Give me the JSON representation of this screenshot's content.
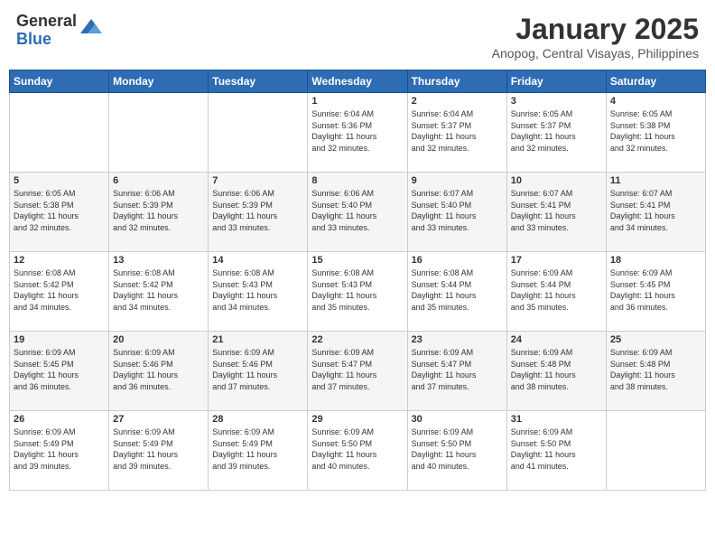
{
  "header": {
    "logo_general": "General",
    "logo_blue": "Blue",
    "month_title": "January 2025",
    "location": "Anopog, Central Visayas, Philippines"
  },
  "weekdays": [
    "Sunday",
    "Monday",
    "Tuesday",
    "Wednesday",
    "Thursday",
    "Friday",
    "Saturday"
  ],
  "weeks": [
    [
      {
        "day": "",
        "info": ""
      },
      {
        "day": "",
        "info": ""
      },
      {
        "day": "",
        "info": ""
      },
      {
        "day": "1",
        "info": "Sunrise: 6:04 AM\nSunset: 5:36 PM\nDaylight: 11 hours\nand 32 minutes."
      },
      {
        "day": "2",
        "info": "Sunrise: 6:04 AM\nSunset: 5:37 PM\nDaylight: 11 hours\nand 32 minutes."
      },
      {
        "day": "3",
        "info": "Sunrise: 6:05 AM\nSunset: 5:37 PM\nDaylight: 11 hours\nand 32 minutes."
      },
      {
        "day": "4",
        "info": "Sunrise: 6:05 AM\nSunset: 5:38 PM\nDaylight: 11 hours\nand 32 minutes."
      }
    ],
    [
      {
        "day": "5",
        "info": "Sunrise: 6:05 AM\nSunset: 5:38 PM\nDaylight: 11 hours\nand 32 minutes."
      },
      {
        "day": "6",
        "info": "Sunrise: 6:06 AM\nSunset: 5:39 PM\nDaylight: 11 hours\nand 32 minutes."
      },
      {
        "day": "7",
        "info": "Sunrise: 6:06 AM\nSunset: 5:39 PM\nDaylight: 11 hours\nand 33 minutes."
      },
      {
        "day": "8",
        "info": "Sunrise: 6:06 AM\nSunset: 5:40 PM\nDaylight: 11 hours\nand 33 minutes."
      },
      {
        "day": "9",
        "info": "Sunrise: 6:07 AM\nSunset: 5:40 PM\nDaylight: 11 hours\nand 33 minutes."
      },
      {
        "day": "10",
        "info": "Sunrise: 6:07 AM\nSunset: 5:41 PM\nDaylight: 11 hours\nand 33 minutes."
      },
      {
        "day": "11",
        "info": "Sunrise: 6:07 AM\nSunset: 5:41 PM\nDaylight: 11 hours\nand 34 minutes."
      }
    ],
    [
      {
        "day": "12",
        "info": "Sunrise: 6:08 AM\nSunset: 5:42 PM\nDaylight: 11 hours\nand 34 minutes."
      },
      {
        "day": "13",
        "info": "Sunrise: 6:08 AM\nSunset: 5:42 PM\nDaylight: 11 hours\nand 34 minutes."
      },
      {
        "day": "14",
        "info": "Sunrise: 6:08 AM\nSunset: 5:43 PM\nDaylight: 11 hours\nand 34 minutes."
      },
      {
        "day": "15",
        "info": "Sunrise: 6:08 AM\nSunset: 5:43 PM\nDaylight: 11 hours\nand 35 minutes."
      },
      {
        "day": "16",
        "info": "Sunrise: 6:08 AM\nSunset: 5:44 PM\nDaylight: 11 hours\nand 35 minutes."
      },
      {
        "day": "17",
        "info": "Sunrise: 6:09 AM\nSunset: 5:44 PM\nDaylight: 11 hours\nand 35 minutes."
      },
      {
        "day": "18",
        "info": "Sunrise: 6:09 AM\nSunset: 5:45 PM\nDaylight: 11 hours\nand 36 minutes."
      }
    ],
    [
      {
        "day": "19",
        "info": "Sunrise: 6:09 AM\nSunset: 5:45 PM\nDaylight: 11 hours\nand 36 minutes."
      },
      {
        "day": "20",
        "info": "Sunrise: 6:09 AM\nSunset: 5:46 PM\nDaylight: 11 hours\nand 36 minutes."
      },
      {
        "day": "21",
        "info": "Sunrise: 6:09 AM\nSunset: 5:46 PM\nDaylight: 11 hours\nand 37 minutes."
      },
      {
        "day": "22",
        "info": "Sunrise: 6:09 AM\nSunset: 5:47 PM\nDaylight: 11 hours\nand 37 minutes."
      },
      {
        "day": "23",
        "info": "Sunrise: 6:09 AM\nSunset: 5:47 PM\nDaylight: 11 hours\nand 37 minutes."
      },
      {
        "day": "24",
        "info": "Sunrise: 6:09 AM\nSunset: 5:48 PM\nDaylight: 11 hours\nand 38 minutes."
      },
      {
        "day": "25",
        "info": "Sunrise: 6:09 AM\nSunset: 5:48 PM\nDaylight: 11 hours\nand 38 minutes."
      }
    ],
    [
      {
        "day": "26",
        "info": "Sunrise: 6:09 AM\nSunset: 5:49 PM\nDaylight: 11 hours\nand 39 minutes."
      },
      {
        "day": "27",
        "info": "Sunrise: 6:09 AM\nSunset: 5:49 PM\nDaylight: 11 hours\nand 39 minutes."
      },
      {
        "day": "28",
        "info": "Sunrise: 6:09 AM\nSunset: 5:49 PM\nDaylight: 11 hours\nand 39 minutes."
      },
      {
        "day": "29",
        "info": "Sunrise: 6:09 AM\nSunset: 5:50 PM\nDaylight: 11 hours\nand 40 minutes."
      },
      {
        "day": "30",
        "info": "Sunrise: 6:09 AM\nSunset: 5:50 PM\nDaylight: 11 hours\nand 40 minutes."
      },
      {
        "day": "31",
        "info": "Sunrise: 6:09 AM\nSunset: 5:50 PM\nDaylight: 11 hours\nand 41 minutes."
      },
      {
        "day": "",
        "info": ""
      }
    ]
  ]
}
